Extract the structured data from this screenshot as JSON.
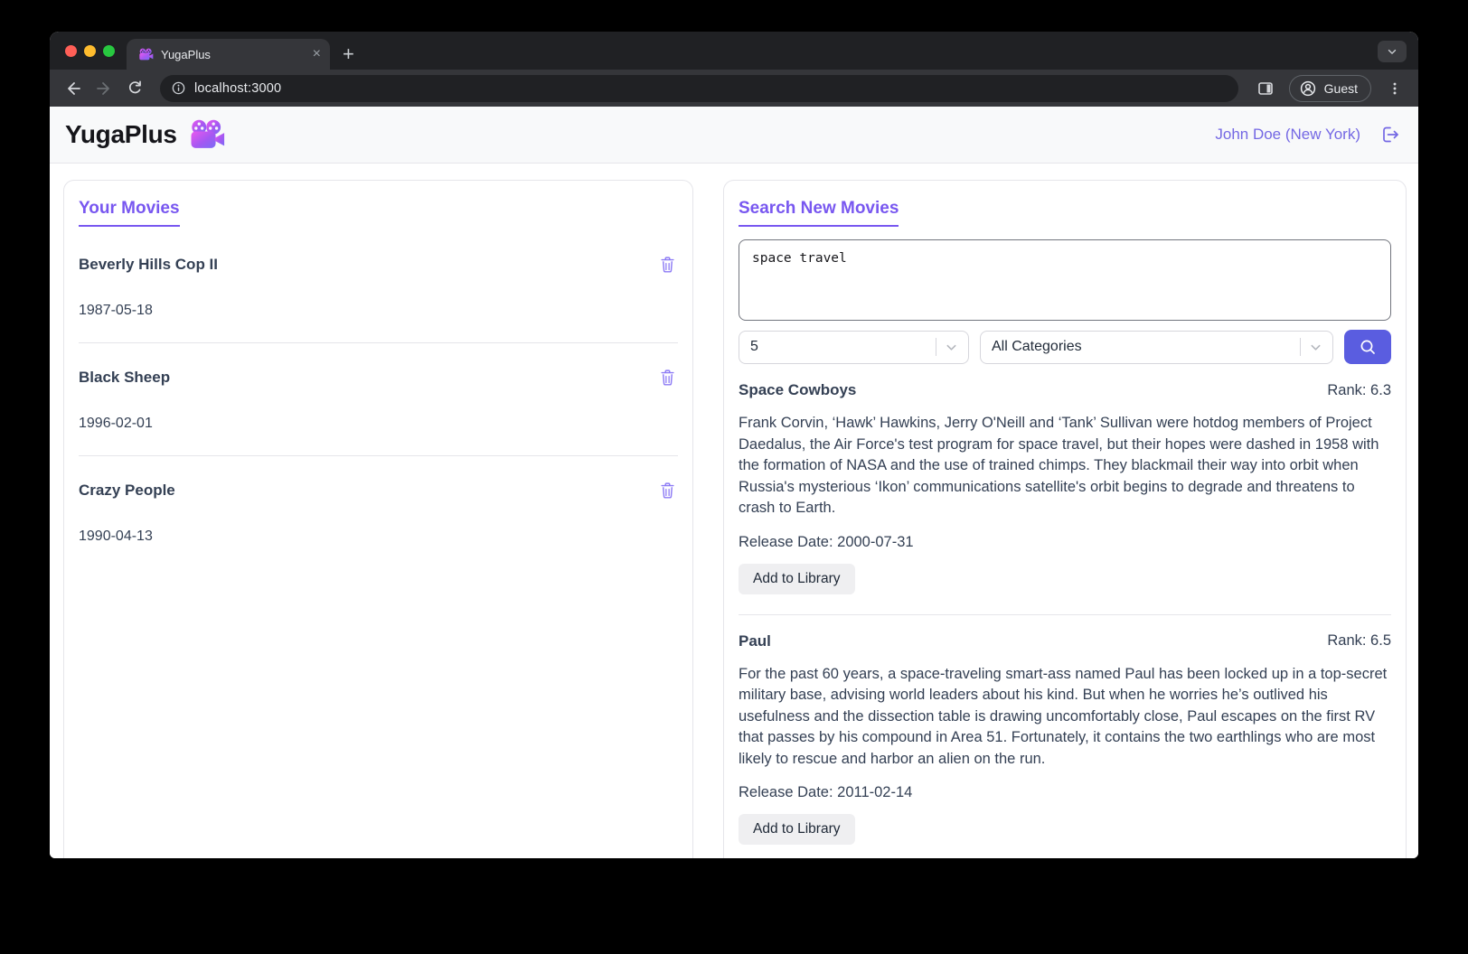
{
  "browser": {
    "tab_title": "YugaPlus",
    "tab_close_glyph": "×",
    "new_tab_glyph": "+",
    "url": "localhost:3000",
    "guest_label": "Guest"
  },
  "header": {
    "brand": "YugaPlus",
    "user": "John Doe (New York)"
  },
  "your_movies": {
    "title": "Your Movies",
    "movies": [
      {
        "title": "Beverly Hills Cop II",
        "date": "1987-05-18"
      },
      {
        "title": "Black Sheep",
        "date": "1996-02-01"
      },
      {
        "title": "Crazy People",
        "date": "1990-04-13"
      }
    ]
  },
  "search": {
    "title": "Search New Movies",
    "query": "space travel",
    "limit": "5",
    "category": "All Categories",
    "results": [
      {
        "title": "Space Cowboys",
        "rank": "Rank: 6.3",
        "description": "Frank Corvin, ‘Hawk’ Hawkins, Jerry O'Neill and ‘Tank’ Sullivan were hotdog members of Project Daedalus, the Air Force's test program for space travel, but their hopes were dashed in 1958 with the formation of NASA and the use of trained chimps. They blackmail their way into orbit when Russia's mysterious ‘Ikon’ communications satellite's orbit begins to degrade and threatens to crash to Earth.",
        "release": "Release Date: 2000-07-31",
        "action": "Add to Library"
      },
      {
        "title": "Paul",
        "rank": "Rank: 6.5",
        "description": "For the past 60 years, a space-traveling smart-ass named Paul has been locked up in a top-secret military base, advising world leaders about his kind. But when he worries he’s outlived his usefulness and the dissection table is drawing uncomfortably close, Paul escapes on the first RV that passes by his compound in Area 51. Fortunately, it contains the two earthlings who are most likely to rescue and harbor an alien on the run.",
        "release": "Release Date: 2011-02-14",
        "action": "Add to Library"
      }
    ]
  },
  "colors": {
    "accent_purple": "#7857f0",
    "search_button": "#5a5de0",
    "body_text": "#344054"
  }
}
